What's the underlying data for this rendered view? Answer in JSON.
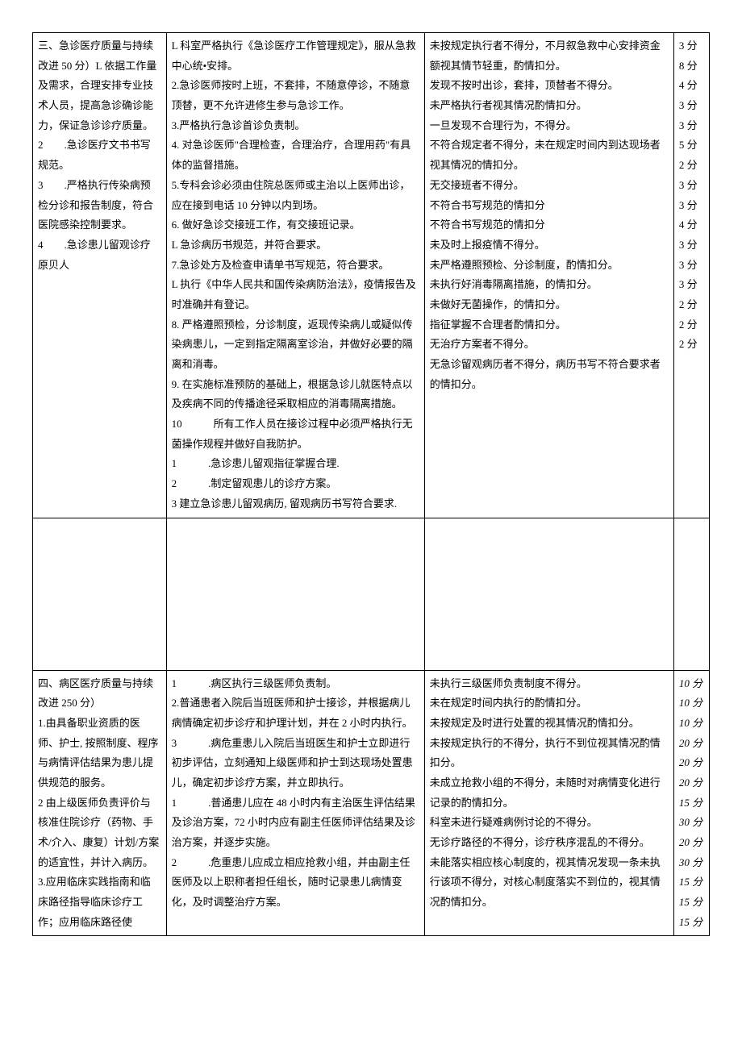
{
  "rows": [
    {
      "col1": "三、急诊医疗质量与持续改进 50 分）L 依据工作量及需求，合理安排专业技术人员，提高急诊确诊能力，保证急诊诊疗质量。\n2　　.急诊医疗文书书写规范。\n3　　.严格执行传染病预检分诊和报告制度，符合医院感染控制要求。\n4　　.急诊患儿留观诊疗原贝人",
      "col2": "L 科室严格执行《急诊医疗工作管理规定》，服从急救中心统•安排。\n2.急诊医师按时上班，不套排，不随意停诊，不随意顶替，更不允许进修生参与急诊工作。\n3.严格执行急诊首诊负责制。\n4. 对急诊医师\"合理检查，合理治疗，合理用药\"有具体的监督措施。\n5.专科会诊必须由住院总医师或主治以上医师出诊，应在接到电话 10 分钟以内到场。\n6. 做好急诊交接班工作，有交接班记录。\nL 急诊病历书规范，并符合要求。\n7.急诊处方及检查申请单书写规范，符合要求。\nL 执行《中华人民共和国传染病防治法》，疫情报告及时准确并有登记。\n8. 严格遵照预检，分诊制度，返现传染病儿或疑似传染病患儿，一定到指定隔离室诊治，并做好必要的隔离和消毒。\n9. 在实施标准预防的基础上，根据急诊儿就医特点以及疾病不同的传播途径采取相应的消毒隔离措施。\n10　　　所有工作人员在接诊过程中必须严格执行无菌操作规程并做好自我防护。\n1　　　.急诊患儿留观指征掌握合理.\n2　　　.制定留观患儿的诊疗方案。\n3 建立急诊患儿留观病历, 留观病历书写符合要求.",
      "col3": "未按规定执行者不得分，不月叙急救中心安排资金额视其情节轻重，酌情扣分。\n发现不按时出诊，套排，顶替者不得分。\n未严格执行者视其情况酌情扣分。\n一旦发现不合理行为，不得分。\n不符合规定者不得分，未在规定时间内到达现场者视其情况的情扣分。\n无交接班者不得分。\n不符合书写规范的情扣分\n不符合书写规范的情扣分\n未及时上报疫情不得分。\n未严格遵照预检、分诊制度，酌情扣分。\n未执行好消毒隔离措施，的情扣分。\n未做好无菌操作，的情扣分。\n指征掌握不合理者酌情扣分。\n无治疗方案者不得分。\n无急诊留观病历者不得分，病历书写不符合要求者的情扣分。",
      "col4": "3 分\n8 分\n4 分\n3 分\n3 分\n5 分\n2 分\n3 分\n3 分\n4 分\n3 分\n3 分\n3 分\n2 分\n2 分\n2 分"
    },
    {
      "col1": "四、病区医疗质量与持续改进 250 分）\n1.由具备职业资质的医师、护士, 按照制度、程序与病情评估结果为患儿提供规范的服务。\n2 由上级医师负责评价与核准住院诊疗（药物、手术/介入、康复）计划/方案的适宜性，并计入病历。\n3.应用临床实践指南和临床路径指导临床诊疗工作；应用临床路径使",
      "col2": "1　　　.病区执行三级医师负责制。\n2.普通患者入院后当班医师和护士接诊，并根据病儿病情确定初步诊疗和护理计划，并在 2 小时内执行。\n3　　　.病危重患儿入院后当班医生和护士立即进行初步评估，立刻通知上级医师和护士到达现场处置患儿，确定初步诊疗方案，并立即执行。\n1　　　.普通患儿应在 48 小时内有主治医生评估结果及诊治方案，72 小时内应有副主任医师评估结果及诊治方案，并逐步实施。\n2　　　.危重患儿应成立相应抢救小组，并由副主任医师及以上职称者担任组长，随时记录患儿病情变化，及时调整治疗方案。",
      "col3": "未执行三级医师负责制度不得分。\n未在规定时间内执行的酌情扣分。\n未按规定及时进行处置的视其情况酌情扣分。\n未按规定执行的不得分，执行不到位视其情况酌情扣分。\n未成立抢救小组的不得分，未随时对病情变化进行记录的酌情扣分。\n科室未进行疑难病例讨论的不得分。\n无诊疗路径的不得分，诊疗秩序混乱的不得分。\n未能落实相应核心制度的，视其情况发现一条未执行该项不得分，对核心制度落实不到位的，视其情况酌情扣分。",
      "col4": "10 分\n10 分\n10 分\n20 分\n20 分\n20 分\n15 分\n30 分\n20 分\n30 分\n15 分\n15 分\n15 分"
    }
  ]
}
